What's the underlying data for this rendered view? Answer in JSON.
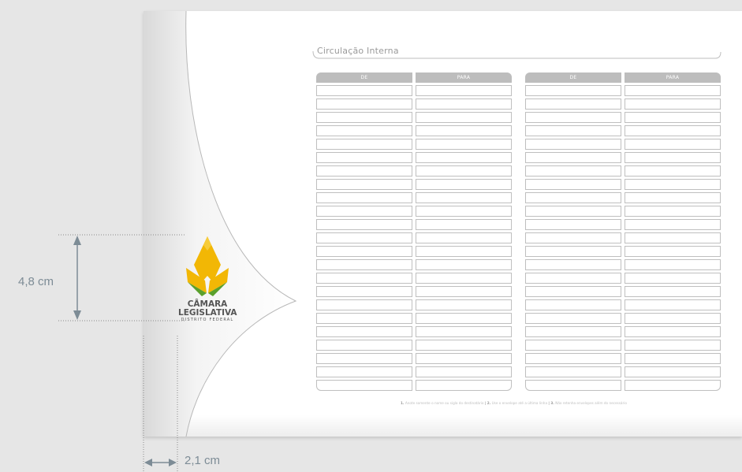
{
  "sheet": {
    "title": "Circulação Interna",
    "tables": [
      {
        "col1": "DE",
        "col2": "PARA"
      },
      {
        "col1": "DE",
        "col2": "PARA"
      }
    ],
    "note": {
      "n1": "1.",
      "t1": " Anote somente o nome ou sigla do destinatário ",
      "n2": "| 2.",
      "t2": " Use o envelope até a última linha ",
      "n3": "| 3.",
      "t3": " Não retenha envelopes além do necessário"
    }
  },
  "logo": {
    "line1": "CÂMARA",
    "line2": "LEGISLATIVA",
    "line3": "DISTRITO FEDERAL"
  },
  "dimensions": {
    "height_label": "4,8 cm",
    "width_label": "2,1 cm"
  },
  "colors": {
    "logo_yellow": "#f2b705",
    "logo_green": "#5aa02c",
    "dimension_gray": "#7d8c96"
  }
}
